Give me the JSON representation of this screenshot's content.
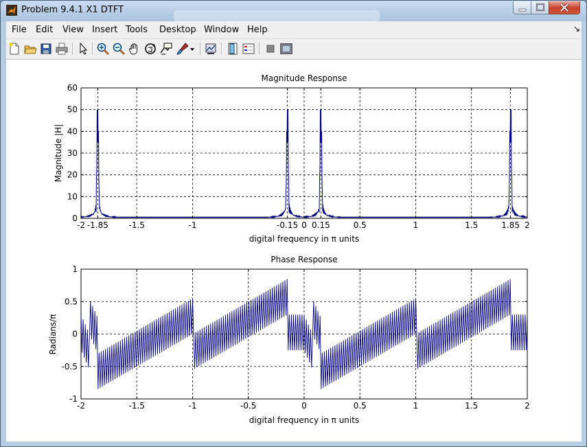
{
  "window": {
    "title": "Problem 9.4.1 X1 DTFT",
    "controls": {
      "minimize_icon": "minimize-icon",
      "maximize_icon": "maximize-icon",
      "close_icon": "close-icon"
    }
  },
  "menu": [
    "File",
    "Edit",
    "View",
    "Insert",
    "Tools",
    "Desktop",
    "Window",
    "Help"
  ],
  "toolbar": [
    "new-figure-icon",
    "open-file-icon",
    "save-icon",
    "print-icon",
    "select-arrow-icon",
    "zoom-in-icon",
    "zoom-out-icon",
    "pan-hand-icon",
    "rotate-3d-icon",
    "data-cursor-icon",
    "brush-icon",
    "link-plot-icon",
    "colorbar-icon",
    "legend-icon",
    "hide-plot-tools-icon",
    "show-plot-tools-icon"
  ],
  "chart_data": [
    {
      "type": "line",
      "title": "Magnitude Response",
      "xlabel": "digital frequency in π units",
      "ylabel": "Magnitude  |H|",
      "xlim": [
        -2,
        2
      ],
      "ylim": [
        0,
        60
      ],
      "xticks": [
        -2,
        -1.85,
        -1.5,
        -1,
        -0.15,
        0,
        0.15,
        0.5,
        1,
        1.5,
        1.85,
        2
      ],
      "xtick_labels": [
        "-2",
        "-1.85",
        "-1.5",
        "-1",
        "-0.15",
        "0",
        "0.15",
        "0.5",
        "1",
        "1.5",
        "1.85",
        "2"
      ],
      "yticks": [
        0,
        10,
        20,
        30,
        40,
        50,
        60
      ],
      "ytick_labels": [
        "0",
        "10",
        "20",
        "30",
        "40",
        "50",
        "60"
      ],
      "grid": true,
      "color": "#00007f",
      "peaks": [
        {
          "x": -1.85,
          "y": 50
        },
        {
          "x": -0.15,
          "y": 50
        },
        {
          "x": 0.15,
          "y": 50
        },
        {
          "x": 1.85,
          "y": 50
        }
      ],
      "sidelobe_level": 10,
      "floor_level": 0.6
    },
    {
      "type": "line",
      "title": "Phase Response",
      "xlabel": "digital frequency in π units",
      "ylabel": "Radians/π",
      "xlim": [
        -2,
        2
      ],
      "ylim": [
        -1,
        1
      ],
      "xticks": [
        -2,
        -1.5,
        -1,
        -0.5,
        0,
        0.5,
        1,
        1.5,
        2
      ],
      "xtick_labels": [
        "-2",
        "-1.5",
        "-1",
        "-0.5",
        "0",
        "0.5",
        "1",
        "1.5",
        "2"
      ],
      "yticks": [
        -1,
        -0.5,
        0,
        0.5,
        1
      ],
      "ytick_labels": [
        "-1",
        "-0.5",
        "0",
        "0.5",
        "1"
      ],
      "grid": true,
      "color": "#00007f",
      "peaks_at": [
        -1.85,
        -0.15,
        0.15,
        1.85
      ]
    }
  ]
}
